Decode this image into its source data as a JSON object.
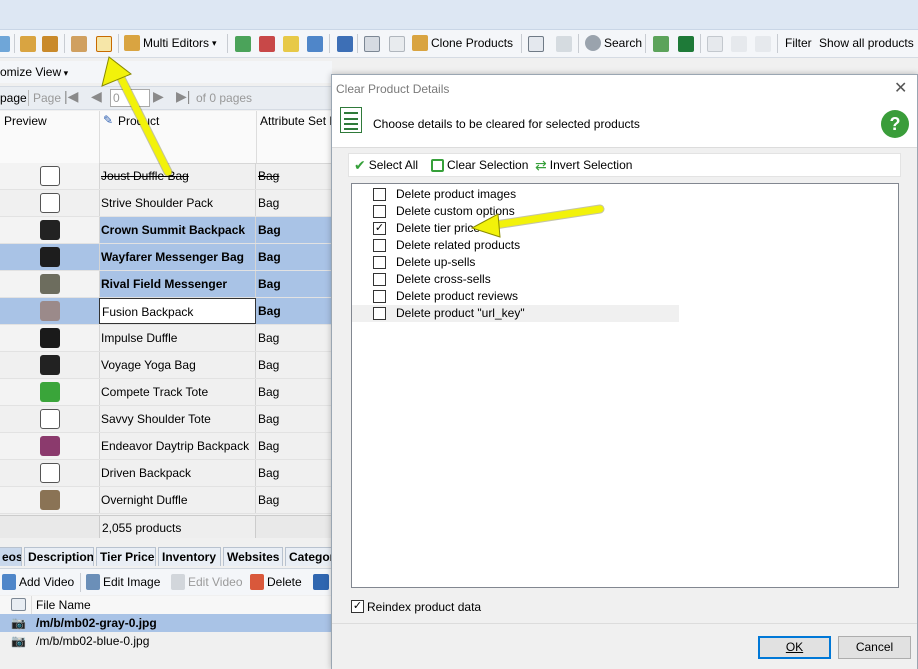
{
  "toolbar": {
    "multi_editors": "Multi Editors",
    "clone_products": "Clone Products",
    "search": "Search",
    "filter_label": "Filter",
    "filter_value": "Show all products"
  },
  "left": {
    "customize_view": "omize View",
    "pager": {
      "page_label_cut": "page",
      "page_label": "Page",
      "page_value": "0",
      "of_pages": "of 0 pages"
    },
    "columns": [
      "Preview",
      "Product",
      "Attribute Set N"
    ],
    "rows": [
      {
        "name": "Joust Duffle Bag",
        "set": "Bag"
      },
      {
        "name": "Strive Shoulder Pack",
        "set": "Bag"
      },
      {
        "name": "Crown Summit Backpack",
        "set": "Bag"
      },
      {
        "name": "Wayfarer Messenger Bag",
        "set": "Bag"
      },
      {
        "name": "Rival Field Messenger",
        "set": "Bag"
      },
      {
        "name": "Fusion Backpack",
        "set": "Bag"
      },
      {
        "name": "Impulse Duffle",
        "set": "Bag"
      },
      {
        "name": "Voyage Yoga Bag",
        "set": "Bag"
      },
      {
        "name": "Compete Track Tote",
        "set": "Bag"
      },
      {
        "name": "Savvy Shoulder Tote",
        "set": "Bag"
      },
      {
        "name": "Endeavor Daytrip Backpack",
        "set": "Bag"
      },
      {
        "name": "Driven Backpack",
        "set": "Bag"
      },
      {
        "name": "Overnight Duffle",
        "set": "Bag"
      }
    ],
    "count": "2,055 products",
    "tabs": [
      "eos",
      "Description",
      "Tier Price",
      "Inventory",
      "Websites",
      "Categor"
    ],
    "subtoolbar": {
      "add_video": "Add Video",
      "edit_image": "Edit Image",
      "edit_video": "Edit Video",
      "delete": "Delete"
    },
    "files_header": "File Name",
    "files": [
      "/m/b/mb02-gray-0.jpg",
      "/m/b/mb02-blue-0.jpg"
    ]
  },
  "dialog": {
    "title": "Clear Product Details",
    "header": "Choose details to be cleared for selected products",
    "select_all": "Select All",
    "clear_selection": "Clear Selection",
    "invert_selection": "Invert Selection",
    "items": [
      {
        "label": "Delete product images",
        "checked": false
      },
      {
        "label": "Delete custom options",
        "checked": false
      },
      {
        "label": "Delete tier price",
        "checked": true
      },
      {
        "label": "Delete related products",
        "checked": false
      },
      {
        "label": "Delete up-sells",
        "checked": false
      },
      {
        "label": "Delete cross-sells",
        "checked": false
      },
      {
        "label": "Delete product reviews",
        "checked": false
      },
      {
        "label": "Delete product \"url_key\"",
        "checked": false
      }
    ],
    "reindex": {
      "label": "Reindex product data",
      "checked": true
    },
    "ok": "OK",
    "cancel": "Cancel"
  },
  "colors": {
    "selection": "#a9c3e6",
    "arrow": "#f2f20a"
  }
}
